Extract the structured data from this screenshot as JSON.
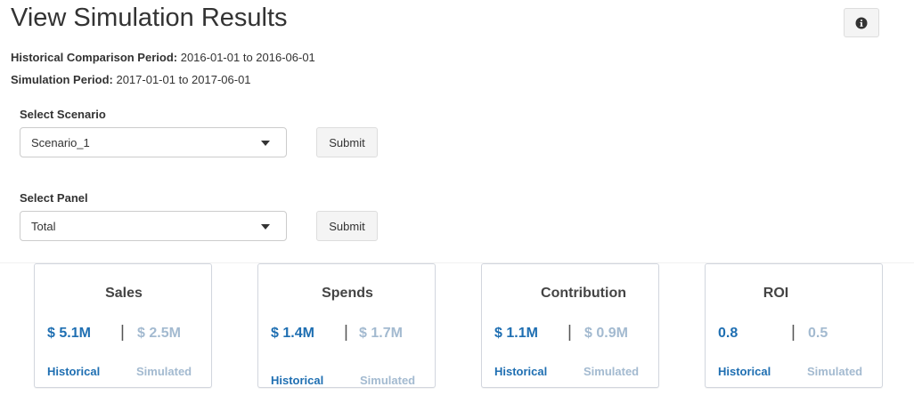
{
  "header": {
    "title": "View Simulation Results",
    "info_icon": "info-circle-icon"
  },
  "periods": {
    "historical_label": "Historical Comparison Period:",
    "historical_value": "2016-01-01 to 2016-06-01",
    "simulation_label": "Simulation Period:",
    "simulation_value": "2017-01-01 to 2017-06-01"
  },
  "scenario": {
    "label": "Select Scenario",
    "selected": "Scenario_1",
    "submit_label": "Submit"
  },
  "panel": {
    "label": "Select Panel",
    "selected": "Total",
    "submit_label": "Submit"
  },
  "colors": {
    "historical": "#1f6fb2",
    "simulated": "#a3bad0"
  },
  "cards": [
    {
      "title": "Sales",
      "historical": "$ 5.1M",
      "simulated": "$ 2.5M",
      "historical_label": "Historical",
      "simulated_label": "Simulated"
    },
    {
      "title": "Spends",
      "historical": "$ 1.4M",
      "simulated": "$ 1.7M",
      "historical_label": "Historical",
      "simulated_label": "Simulated"
    },
    {
      "title": "Contribution",
      "historical": "$ 1.1M",
      "simulated": "$ 0.9M",
      "historical_label": "Historical",
      "simulated_label": "Simulated"
    },
    {
      "title": "ROI",
      "historical": "0.8",
      "simulated": "0.5",
      "historical_label": "Historical",
      "simulated_label": "Simulated"
    }
  ],
  "separator": "|"
}
